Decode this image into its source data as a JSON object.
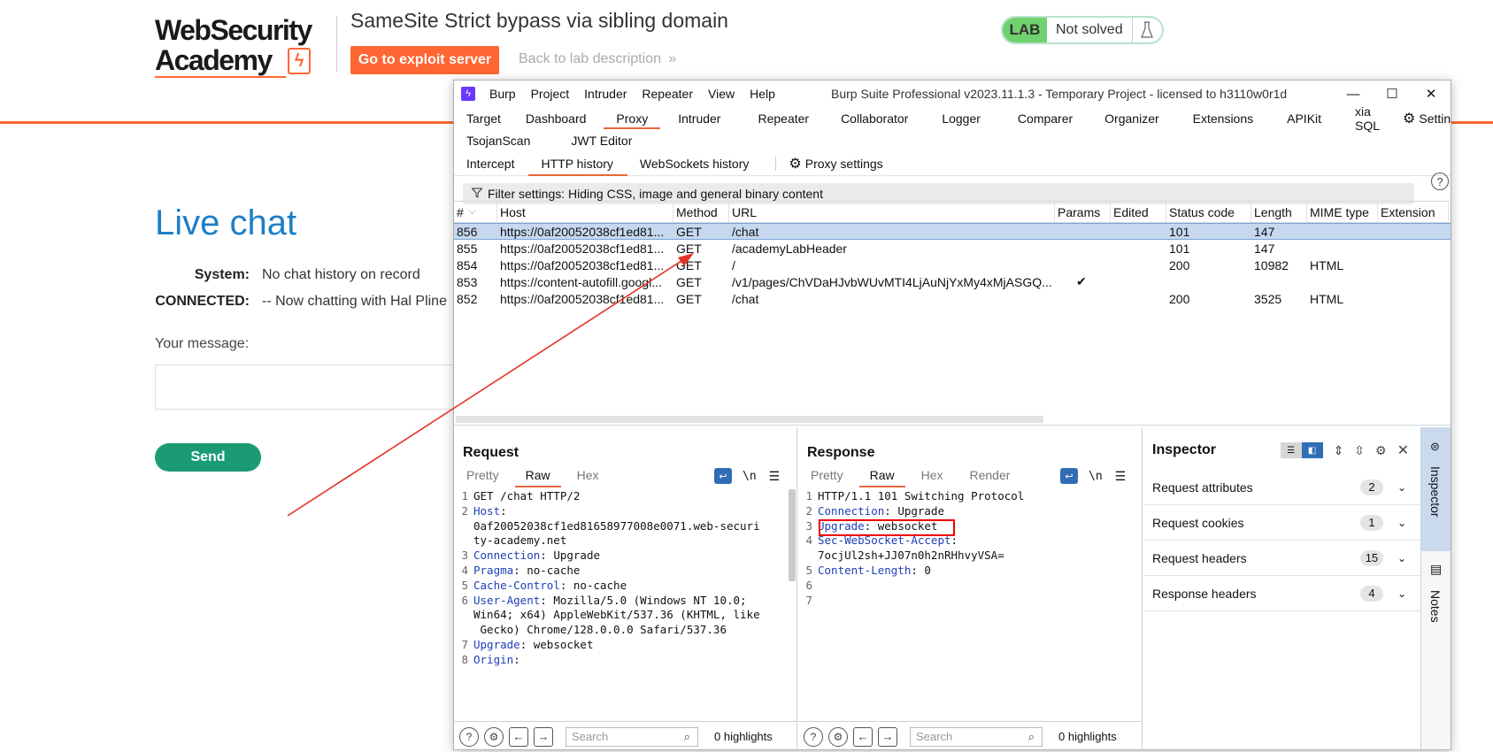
{
  "site": {
    "logo_line1": "WebSecurity",
    "logo_line2": "Academy",
    "lab_title": "SameSite Strict bypass via sibling domain",
    "exploit_button": "Go to exploit server",
    "back_link": "Back to lab description",
    "back_chevron": "»",
    "lab_badge": "LAB",
    "lab_status": "Not solved",
    "brand_color": "#ff6633"
  },
  "chat": {
    "heading": "Live chat",
    "rows": [
      {
        "label": "System:",
        "text": "No chat history on record"
      },
      {
        "label": "CONNECTED:",
        "text": "-- Now chatting with Hal Pline"
      }
    ],
    "message_label": "Your message:",
    "send_button": "Send"
  },
  "burp": {
    "menu": [
      "Burp",
      "Project",
      "Intruder",
      "Repeater",
      "View",
      "Help"
    ],
    "window_title": "Burp Suite Professional v2023.11.1.3 - Temporary Project - licensed to h3110w0r1d",
    "main_tabs_row1": [
      "Target",
      "Dashboard",
      "Proxy",
      "Intruder",
      "Repeater",
      "Collaborator",
      "Logger",
      "Comparer",
      "Organizer",
      "Extensions",
      "APIKit",
      "xia SQL",
      "Settings"
    ],
    "main_tabs_row2": [
      "TsojanScan",
      "JWT Editor"
    ],
    "active_main_tab": "Proxy",
    "sub_tabs": [
      "Intercept",
      "HTTP history",
      "WebSockets history"
    ],
    "proxy_settings": "Proxy settings",
    "filter_text": "Filter settings: Hiding CSS, image and general binary content",
    "history": {
      "columns": [
        "#",
        "Host",
        "Method",
        "URL",
        "Params",
        "Edited",
        "Status code",
        "Length",
        "MIME type",
        "Extension"
      ],
      "rows": [
        {
          "num": "856",
          "host": "https://0af20052038cf1ed81...",
          "method": "GET",
          "url": "/chat",
          "params": "",
          "edited": "",
          "status": "101",
          "length": "147",
          "mime": "",
          "ext": "",
          "selected": true
        },
        {
          "num": "855",
          "host": "https://0af20052038cf1ed81...",
          "method": "GET",
          "url": "/academyLabHeader",
          "params": "",
          "edited": "",
          "status": "101",
          "length": "147",
          "mime": "",
          "ext": ""
        },
        {
          "num": "854",
          "host": "https://0af20052038cf1ed81...",
          "method": "GET",
          "url": "/",
          "params": "",
          "edited": "",
          "status": "200",
          "length": "10982",
          "mime": "HTML",
          "ext": ""
        },
        {
          "num": "853",
          "host": "https://content-autofill.googl...",
          "method": "GET",
          "url": "/v1/pages/ChVDaHJvbWUvMTI4LjAuNjYxMy4xMjASGQ...",
          "params": "✔",
          "edited": "",
          "status": "",
          "length": "",
          "mime": "",
          "ext": ""
        },
        {
          "num": "852",
          "host": "https://0af20052038cf1ed81...",
          "method": "GET",
          "url": "/chat",
          "params": "",
          "edited": "",
          "status": "200",
          "length": "3525",
          "mime": "HTML",
          "ext": ""
        }
      ]
    },
    "request": {
      "title": "Request",
      "tabs": [
        "Pretty",
        "Raw",
        "Hex"
      ],
      "active_tab": "Raw",
      "lines": [
        {
          "no": "1",
          "key": "",
          "val": "GET /chat HTTP/2"
        },
        {
          "no": "2",
          "key": "Host",
          "val": ":"
        },
        {
          "no": "",
          "key": "",
          "val": "0af20052038cf1ed81658977008e0071.web-securi"
        },
        {
          "no": "",
          "key": "",
          "val": "ty-academy.net"
        },
        {
          "no": "3",
          "key": "Connection",
          "val": ": Upgrade"
        },
        {
          "no": "4",
          "key": "Pragma",
          "val": ": no-cache"
        },
        {
          "no": "5",
          "key": "Cache-Control",
          "val": ": no-cache"
        },
        {
          "no": "6",
          "key": "User-Agent",
          "val": ": Mozilla/5.0 (Windows NT 10.0;"
        },
        {
          "no": "",
          "key": "",
          "val": "Win64; x64) AppleWebKit/537.36 (KHTML, like"
        },
        {
          "no": "",
          "key": "",
          "val": " Gecko) Chrome/128.0.0.0 Safari/537.36"
        },
        {
          "no": "7",
          "key": "Upgrade",
          "val": ": websocket"
        },
        {
          "no": "8",
          "key": "Origin",
          "val": ":"
        }
      ],
      "search_placeholder": "Search",
      "highlights": "0 highlights"
    },
    "response": {
      "title": "Response",
      "tabs": [
        "Pretty",
        "Raw",
        "Hex",
        "Render"
      ],
      "active_tab": "Raw",
      "lines": [
        {
          "no": "1",
          "key": "",
          "val": "HTTP/1.1 101 Switching Protocol"
        },
        {
          "no": "2",
          "key": "Connection",
          "val": ": Upgrade"
        },
        {
          "no": "3",
          "key": "Upgrade",
          "val": ": websocket"
        },
        {
          "no": "4",
          "key": "Sec-WebSocket-Accept",
          "val": ":"
        },
        {
          "no": "",
          "key": "",
          "val": "7ocjUl2sh+JJ07n0h2nRHhvyVSA="
        },
        {
          "no": "5",
          "key": "Content-Length",
          "val": ": 0"
        },
        {
          "no": "6",
          "key": "",
          "val": ""
        },
        {
          "no": "7",
          "key": "",
          "val": ""
        }
      ],
      "search_placeholder": "Search",
      "highlights": "0 highlights"
    },
    "inspector": {
      "title": "Inspector",
      "items": [
        {
          "label": "Request attributes",
          "count": "2"
        },
        {
          "label": "Request cookies",
          "count": "1"
        },
        {
          "label": "Request headers",
          "count": "15"
        },
        {
          "label": "Response headers",
          "count": "4"
        }
      ]
    },
    "sidebar": {
      "inspector": "Inspector",
      "notes": "Notes"
    },
    "accent_color": "#e8673c",
    "highlight_color": "#dd0000"
  }
}
